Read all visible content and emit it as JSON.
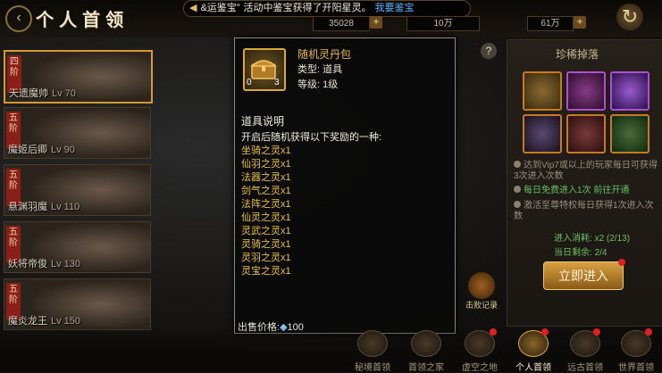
{
  "header": {
    "title": "个人首领",
    "back_icon": "back-arrow-icon",
    "marquee": {
      "prefix": "&运鉴宝”",
      "text": "活动中鉴宝获得了开阳星灵。",
      "link": "我要鉴宝"
    },
    "resources": [
      {
        "icon": "gold-ingot-icon",
        "value": "35028"
      },
      {
        "icon": "silver-icon",
        "value": "10万"
      },
      {
        "icon": "diamond-icon",
        "value": "61万"
      }
    ]
  },
  "boss_list": [
    {
      "tag": "四阶",
      "name": "天遗魔帅",
      "level": "Lv 70",
      "selected": true
    },
    {
      "tag": "五阶",
      "name": "魔姬后卿",
      "level": "Lv 90",
      "selected": false
    },
    {
      "tag": "五阶",
      "name": "悬渊羽魔",
      "level": "Lv 110",
      "selected": false
    },
    {
      "tag": "五阶",
      "name": "妖将帝俊",
      "level": "Lv 130",
      "selected": false
    },
    {
      "tag": "五阶",
      "name": "魔炎龙王",
      "level": "Lv 150",
      "selected": false
    }
  ],
  "tooltip": {
    "item_name": "随机灵丹包",
    "item_type": "类型: 道具",
    "item_level": "等级: 1级",
    "item_icon": "chest-icon",
    "count_left": "0",
    "count_right": "3",
    "section_title": "道具说明",
    "description": "开启后随机获得以下奖励的一种:",
    "rewards": [
      "坐骑之灵x1",
      "仙羽之灵x1",
      "法器之灵x1",
      "剑气之灵x1",
      "法阵之灵x1",
      "仙灵之灵x1",
      "灵武之灵x1",
      "灵骑之灵x1",
      "灵羽之灵x1",
      "灵宝之灵x1"
    ],
    "price_label": "出售价格:",
    "price_value": "100"
  },
  "right_panel": {
    "title": "珍稀掉落",
    "rule1": "达到Vip7或以上的玩家每日可获得3次进入次数",
    "rule2_free": "每日免费进入1次",
    "rule2_tail": "前往开通",
    "rule3": "激活至尊特权每日获得1次进入次数",
    "enter_count_label": "进入消耗:",
    "enter_count_value": "x2 (2/13)",
    "today_kills_label": "当日剩余:",
    "today_kills_value": "2/4",
    "enter_button": "立即进入",
    "kill_record": "击败记录"
  },
  "bottom_nav": [
    {
      "label": "秘境首领",
      "active": false
    },
    {
      "label": "首领之家",
      "active": false
    },
    {
      "label": "虚空之地",
      "active": false
    },
    {
      "label": "个人首领",
      "active": true
    },
    {
      "label": "远古首领",
      "active": false
    },
    {
      "label": "世界首领",
      "active": false
    }
  ],
  "colors": {
    "accent": "#e8b84a",
    "reward_text": "#e8c040",
    "link": "#58b4ff",
    "active_nav": "#fff0cc"
  }
}
